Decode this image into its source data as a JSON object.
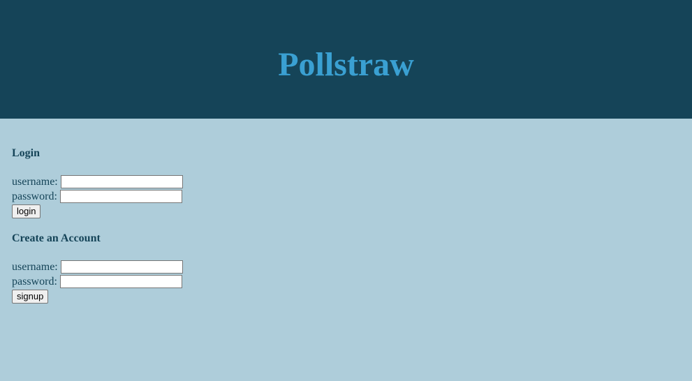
{
  "header": {
    "title": "Pollstraw"
  },
  "login": {
    "heading": "Login",
    "username_label": "username:",
    "username_value": "",
    "password_label": "password:",
    "password_value": "",
    "button_label": "login"
  },
  "signup": {
    "heading": "Create an Account",
    "username_label": "username:",
    "username_value": "",
    "password_label": "password:",
    "password_value": "",
    "button_label": "signup"
  },
  "colors": {
    "header_bg": "#154458",
    "title": "#3aa0d2",
    "page_bg": "#aecdda",
    "text": "#154458"
  }
}
